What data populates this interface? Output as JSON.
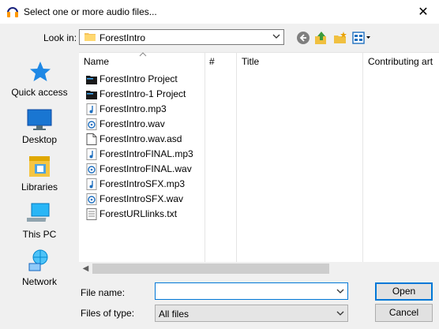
{
  "window": {
    "title": "Select one or more audio files..."
  },
  "look_in": {
    "label": "Look in:",
    "value": "ForestIntro"
  },
  "places": [
    {
      "label": "Quick access",
      "icon": "star-icon"
    },
    {
      "label": "Desktop",
      "icon": "desktop-icon"
    },
    {
      "label": "Libraries",
      "icon": "libraries-icon"
    },
    {
      "label": "This PC",
      "icon": "computer-icon"
    },
    {
      "label": "Network",
      "icon": "network-icon"
    }
  ],
  "columns": {
    "name": "Name",
    "number": "#",
    "title": "Title",
    "contributing": "Contributing art"
  },
  "files": [
    {
      "name": "ForestIntro Project",
      "icon": "folder-dark-icon"
    },
    {
      "name": "ForestIntro-1 Project",
      "icon": "folder-dark-icon"
    },
    {
      "name": "ForestIntro.mp3",
      "icon": "mp3-file-icon"
    },
    {
      "name": "ForestIntro.wav",
      "icon": "wav-file-icon"
    },
    {
      "name": "ForestIntro.wav.asd",
      "icon": "generic-file-icon"
    },
    {
      "name": "ForestIntroFINAL.mp3",
      "icon": "mp3-file-icon"
    },
    {
      "name": "ForestIntroFINAL.wav",
      "icon": "wav-file-icon"
    },
    {
      "name": "ForestIntroSFX.mp3",
      "icon": "mp3-file-icon"
    },
    {
      "name": "ForestIntroSFX.wav",
      "icon": "wav-file-icon"
    },
    {
      "name": "ForestURLlinks.txt",
      "icon": "text-file-icon"
    }
  ],
  "file_name": {
    "label": "File name:",
    "value": ""
  },
  "file_type": {
    "label": "Files of type:",
    "value": "All files"
  },
  "buttons": {
    "open": "Open",
    "cancel": "Cancel",
    "close": "✕"
  },
  "colors": {
    "accent": "#0078d7",
    "dialog_bg": "#f0f0f0"
  }
}
